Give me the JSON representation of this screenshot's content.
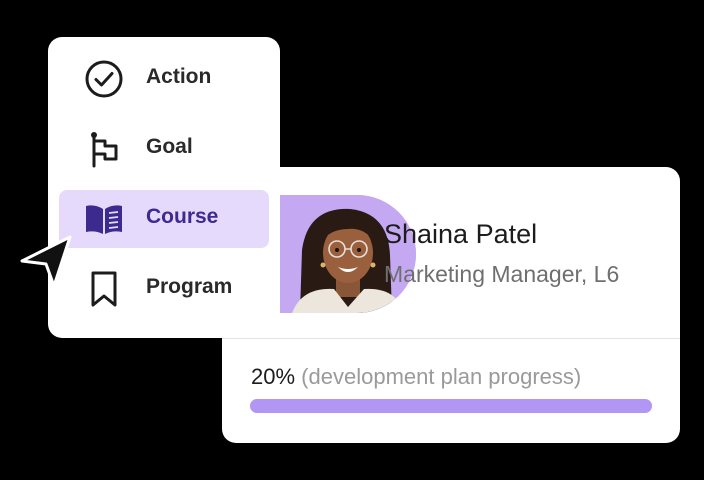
{
  "menu": {
    "items": [
      {
        "label": "Action",
        "icon": "check-circle-icon",
        "active": false
      },
      {
        "label": "Goal",
        "icon": "flag-icon",
        "active": false
      },
      {
        "label": "Course",
        "icon": "book-open-icon",
        "active": true
      },
      {
        "label": "Program",
        "icon": "bookmark-icon",
        "active": false
      }
    ]
  },
  "profile": {
    "name": "Shaina Patel",
    "role": "Marketing Manager, L6"
  },
  "progress": {
    "value_text": "20%",
    "label": "(development plan progress)",
    "percent": 100
  },
  "colors": {
    "background": "#000000",
    "accent": "#b197f3",
    "accent_light": "#e6dafc",
    "accent_dark": "#3d2a8f",
    "avatar_bg": "#c4a8f2"
  }
}
